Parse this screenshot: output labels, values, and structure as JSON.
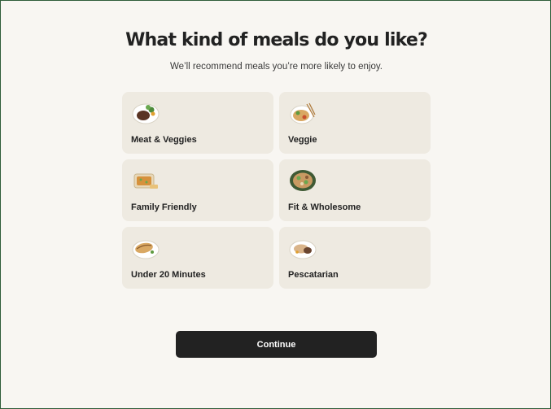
{
  "page": {
    "title": "What kind of meals do you like?",
    "subtitle": "We’ll recommend meals you’re more likely to enjoy."
  },
  "options": [
    {
      "label": "Meat & Veggies",
      "icon": "meat-veggies-plate-icon"
    },
    {
      "label": "Veggie",
      "icon": "veggie-noodle-bowl-icon"
    },
    {
      "label": "Family Friendly",
      "icon": "casserole-dish-icon"
    },
    {
      "label": "Fit & Wholesome",
      "icon": "salad-bowl-icon"
    },
    {
      "label": "Under 20 Minutes",
      "icon": "burrito-plate-icon"
    },
    {
      "label": "Pescatarian",
      "icon": "fish-plate-icon"
    }
  ],
  "continue_label": "Continue",
  "colors": {
    "background": "#f8f6f2",
    "card": "#eeeae1",
    "button": "#222222",
    "border": "#2f5e3a"
  }
}
